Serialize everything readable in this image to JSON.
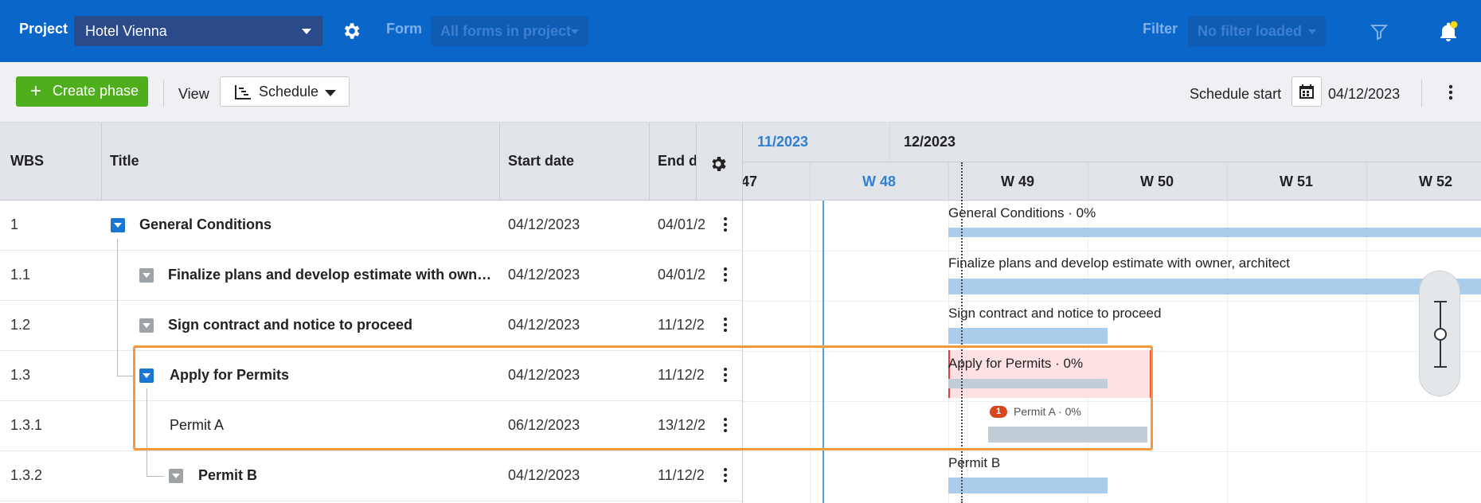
{
  "topbar": {
    "project_label": "Project",
    "project_value": "Hotel Vienna",
    "form_label": "Form",
    "form_value": "All forms in project",
    "filter_label": "Filter",
    "filter_value": "No filter loaded",
    "notification_dot_color": "#f5d90a"
  },
  "toolbar": {
    "create_label": "Create phase",
    "view_label": "View",
    "view_value": "Schedule",
    "schedule_start_label": "Schedule start",
    "schedule_start_value": "04/12/2023"
  },
  "table": {
    "headers": {
      "wbs": "WBS",
      "title": "Title",
      "start": "Start date",
      "end": "End da"
    },
    "rows": [
      {
        "wbs": "1",
        "title": "General Conditions",
        "start": "04/12/2023",
        "end": "04/01/2",
        "bold": true
      },
      {
        "wbs": "1.1",
        "title": "Finalize plans and develop estimate with owner, arc…",
        "start": "04/12/2023",
        "end": "04/01/2",
        "bold": true
      },
      {
        "wbs": "1.2",
        "title": "Sign contract and notice to proceed",
        "start": "04/12/2023",
        "end": "11/12/2",
        "bold": true
      },
      {
        "wbs": "1.3",
        "title": "Apply for Permits",
        "start": "04/12/2023",
        "end": "11/12/2",
        "bold": true
      },
      {
        "wbs": "1.3.1",
        "title": "Permit A",
        "start": "06/12/2023",
        "end": "13/12/2",
        "bold": false
      },
      {
        "wbs": "1.3.2",
        "title": "Permit B",
        "start": "04/12/2023",
        "end": "11/12/2",
        "bold": true
      }
    ]
  },
  "gantt": {
    "months": [
      "11/2023",
      "12/2023"
    ],
    "weeks": [
      "47",
      "W 48",
      "W 49",
      "W 50",
      "W 51",
      "W 52"
    ],
    "bars": [
      {
        "label": "General Conditions · 0%"
      },
      {
        "label": "Finalize plans and develop estimate with owner, architect"
      },
      {
        "label": "Sign contract and notice to proceed"
      },
      {
        "label": "Apply for Permits · 0%"
      },
      {
        "label": "Permit A · 0%",
        "badge": "1"
      },
      {
        "label": "Permit B"
      }
    ]
  },
  "colors": {
    "brand": "#0a66c8",
    "create_button": "#4fae1c",
    "selection_outline": "#f39a3c",
    "critical": "#e43b3b",
    "bar": "#a9cdea",
    "current_week": "#2f80d0"
  }
}
